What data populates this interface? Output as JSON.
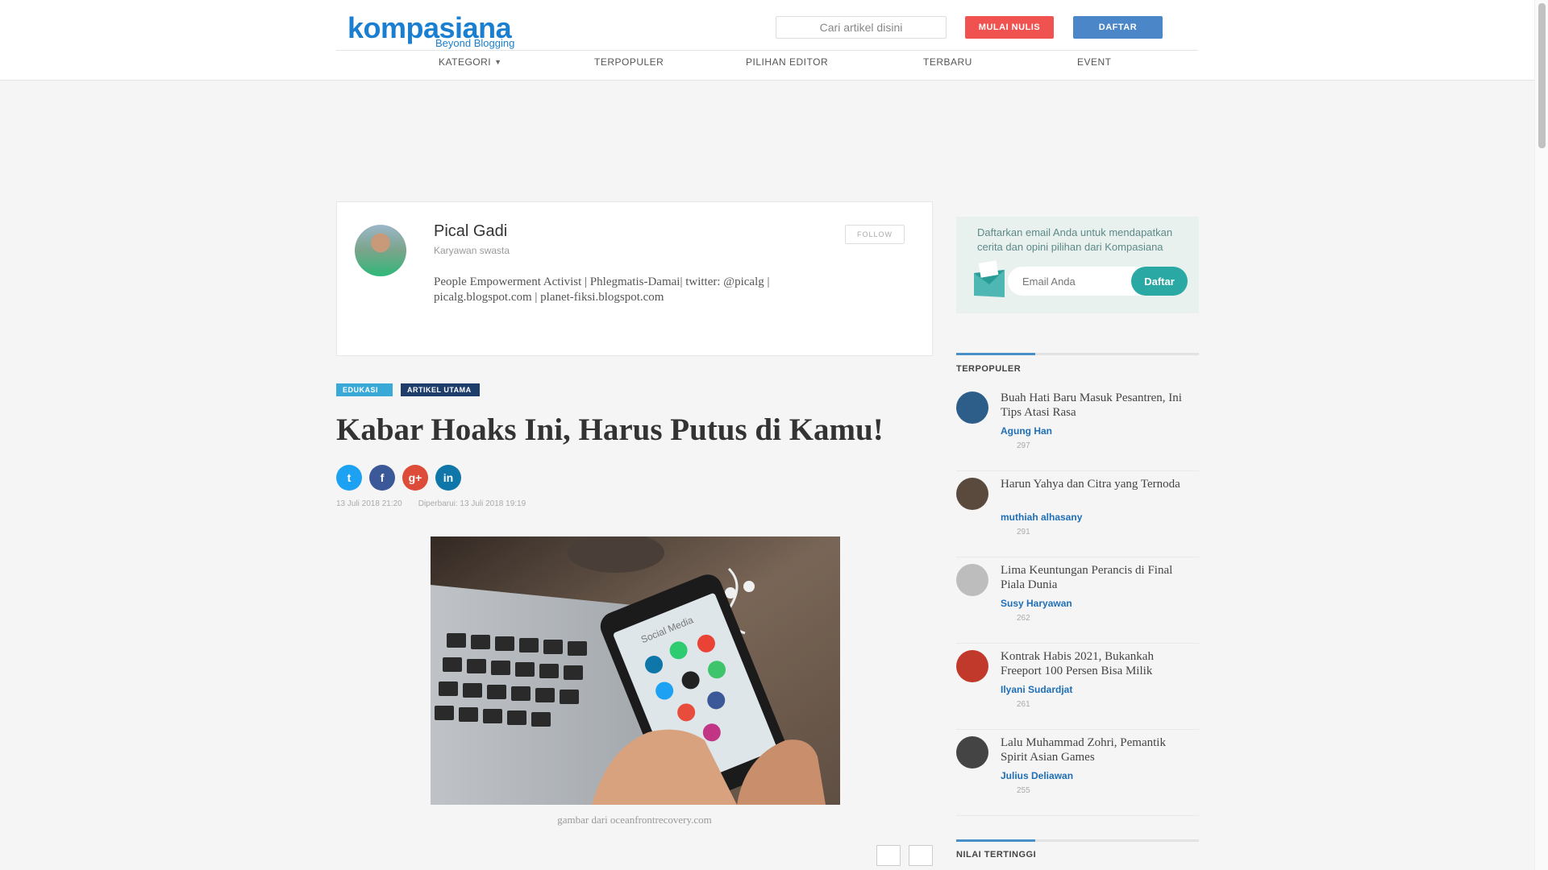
{
  "header": {
    "logo_word": "kompasiana",
    "logo_tagline": "Beyond Blogging",
    "search_placeholder": "Cari artikel disini",
    "write_button": "MULAI NULIS",
    "register_button": "DAFTAR",
    "nav": [
      {
        "label": "KATEGORI"
      },
      {
        "label": "TERPOPULER"
      },
      {
        "label": "PILIHAN EDITOR"
      },
      {
        "label": "TERBARU"
      },
      {
        "label": "EVENT"
      }
    ]
  },
  "author": {
    "name": "Pical Gadi",
    "role": "Karyawan swasta",
    "bio": "People Empowerment Activist | Phlegmatis-Damai| twitter: @picalg | picalg.blogspot.com | planet-fiksi.blogspot.com",
    "follow_button": "FOLLOW"
  },
  "article": {
    "tags": [
      "EDUKASI",
      "ARTIKEL UTAMA"
    ],
    "title": "Kabar Hoaks Ini, Harus Putus di Kamu!",
    "published": "13 Juli 2018   21:20",
    "updated": "Diperbarui: 13 Juli 2018   19:19",
    "image_caption": "gambar dari oceanfrontrecovery.com",
    "share": [
      {
        "name": "twitter",
        "icon": "twitter-icon",
        "glyph": "t"
      },
      {
        "name": "facebook",
        "icon": "facebook-icon",
        "glyph": "f"
      },
      {
        "name": "google-plus",
        "icon": "google-plus-icon",
        "glyph": "g+"
      },
      {
        "name": "linkedin",
        "icon": "linkedin-icon",
        "glyph": "in"
      }
    ],
    "image_labels": {
      "phone_text": "Social Media"
    }
  },
  "newsletter": {
    "text": "Daftarkan email Anda untuk mendapatkan cerita dan opini pilihan dari Kompasiana",
    "placeholder": "Email Anda",
    "button": "Daftar"
  },
  "sidebar": {
    "popular_title": "TERPOPULER",
    "top_rated_title": "NILAI TERTINGGI",
    "popular": [
      {
        "title": "Buah Hati Baru Masuk Pesantren, Ini Tips Atasi Rasa",
        "author": "Agung Han",
        "views": "297",
        "thumb_color": "#2d5e8a"
      },
      {
        "title": "Harun Yahya dan Citra yang Ternoda",
        "author": "muthiah alhasany",
        "views": "291",
        "thumb_color": "#5a4a3e"
      },
      {
        "title": "Lima Keuntungan Perancis di Final Piala Dunia",
        "author": "Susy Haryawan",
        "views": "262",
        "thumb_color": "#bdbdbd"
      },
      {
        "title": "Kontrak Habis 2021, Bukankah Freeport 100 Persen Bisa Milik",
        "author": "Ilyani Sudardjat",
        "views": "261",
        "thumb_color": "#c0392b"
      },
      {
        "title": "Lalu Muhammad Zohri, Pemantik Spirit Asian Games",
        "author": "Julius Deliawan",
        "views": "255",
        "thumb_color": "#444"
      }
    ]
  },
  "colors": {
    "brand": "#1a7fd0",
    "write_button": "#f0534f",
    "register_button": "#4a86c8",
    "newsletter_button": "#2aa9a4",
    "tag_edu": "#39a9d8",
    "tag_main": "#1e3d6b"
  }
}
